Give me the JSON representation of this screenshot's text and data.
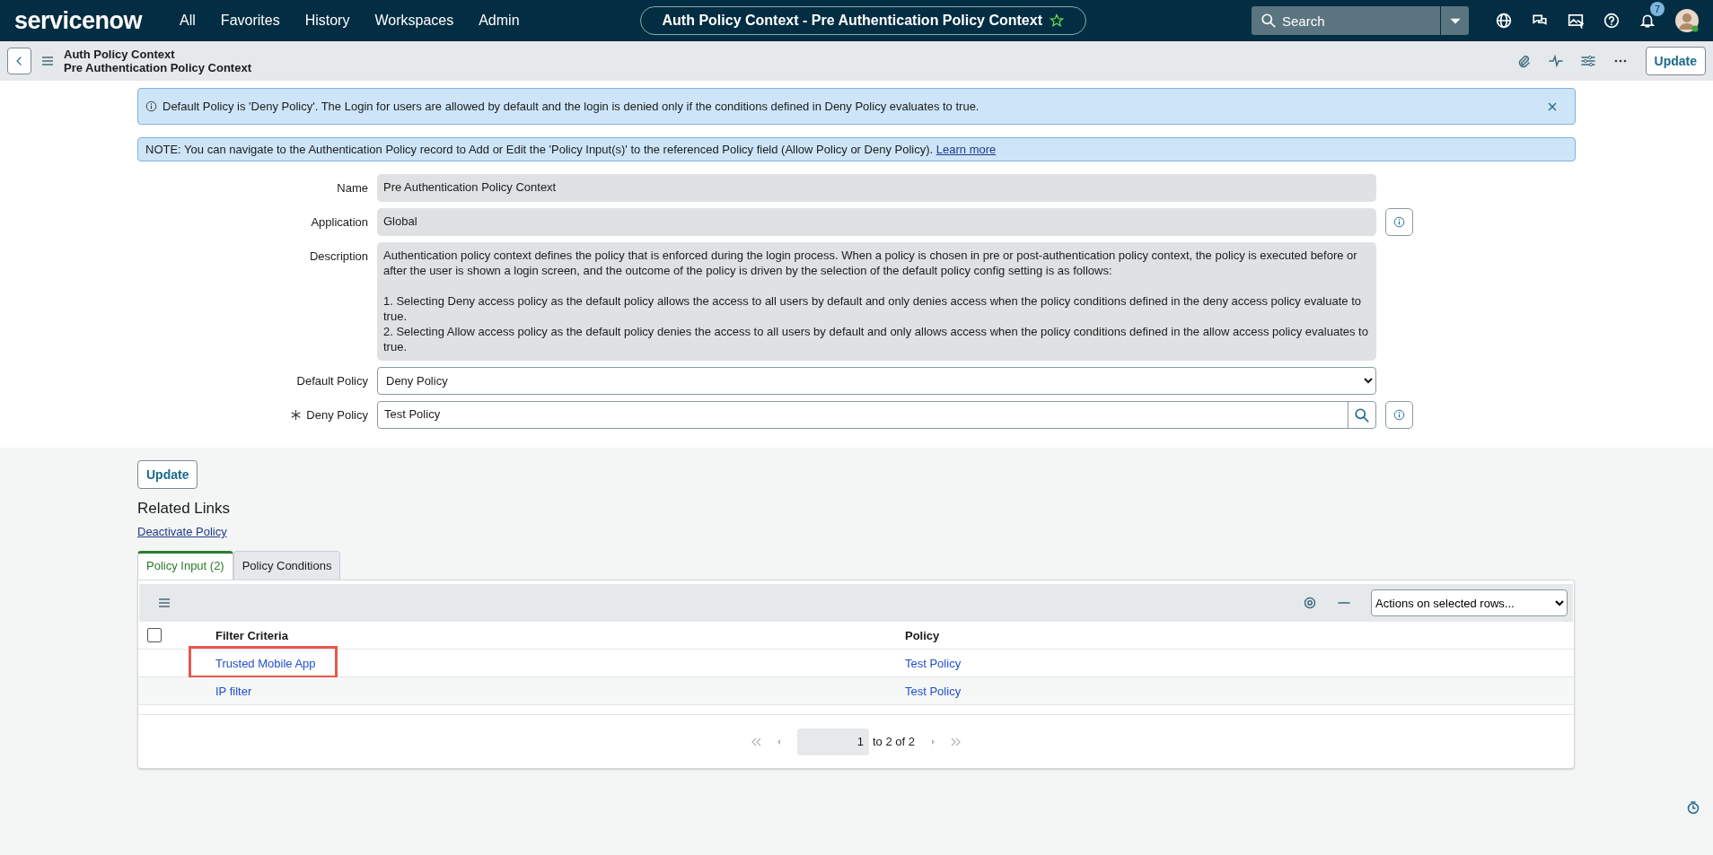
{
  "nav": {
    "logo": "servicenow",
    "menu": [
      "All",
      "Favorites",
      "History",
      "Workspaces",
      "Admin"
    ],
    "title": "Auth Policy Context - Pre Authentication Policy Context",
    "starred": false,
    "search_placeholder": "Search",
    "notification_count": "7"
  },
  "header": {
    "lines": [
      "Auth Policy Context",
      "Pre Authentication Policy Context"
    ],
    "button": "Update"
  },
  "banners": [
    {
      "kind": "info",
      "text": "Default Policy is 'Deny Policy'. The Login for users are allowed by default and the login is denied only if the conditions defined in Deny Policy evaluates to true.",
      "dismissible": true
    },
    {
      "kind": "note",
      "text": "NOTE: You can navigate to the Authentication Policy record to Add or Edit the 'Policy Input(s)' to the referenced Policy field (Allow Policy or Deny Policy).",
      "link": "Learn more",
      "dismissible": false
    }
  ],
  "fields": [
    {
      "kind": "readonly",
      "label": "Name",
      "value": "Pre Authentication Policy Context",
      "required": false,
      "info": false
    },
    {
      "kind": "readonly",
      "label": "Application",
      "value": "Global",
      "required": false,
      "info": true
    },
    {
      "kind": "textarea",
      "label": "Description",
      "value": "Authentication policy context defines the policy that is enforced during the login process. When a policy is chosen in pre or post-authentication policy context, the policy is executed before or after the user is shown a login screen, and the outcome of the policy is driven by the selection of the default policy config setting is as follows:\n\n1. Selecting Deny access policy as the default policy allows the access to all users by default and only denies access when the policy conditions defined in the deny access policy evaluate to true.\n2. Selecting Allow access policy as the default policy denies the access to all users by default and only allows access when the policy conditions defined in the allow access policy evaluates to true.",
      "required": false,
      "info": false
    },
    {
      "kind": "select",
      "label": "Default Policy",
      "value": "Deny Policy",
      "required": false,
      "info": false
    },
    {
      "kind": "reference",
      "label": "Deny Policy",
      "value": "Test Policy",
      "required": true,
      "info": true
    }
  ],
  "update_button": "Update",
  "related_links": {
    "title": "Related Links",
    "links": [
      "Deactivate Policy"
    ]
  },
  "tabs": [
    {
      "label": "Policy Input (2)",
      "selected": true
    },
    {
      "label": "Policy Conditions",
      "selected": false
    }
  ],
  "list": {
    "actions": "Actions on selected rows...",
    "columns": [
      "Filter Criteria",
      "Policy"
    ],
    "all_checked": false,
    "rows": [
      {
        "cells": [
          "Trusted Mobile App",
          "Test Policy"
        ],
        "highlighted": true
      },
      {
        "cells": [
          "IP filter",
          "Test Policy"
        ],
        "highlighted": false
      }
    ],
    "pagination": {
      "page": "1",
      "range": "to 2 of 2"
    }
  }
}
